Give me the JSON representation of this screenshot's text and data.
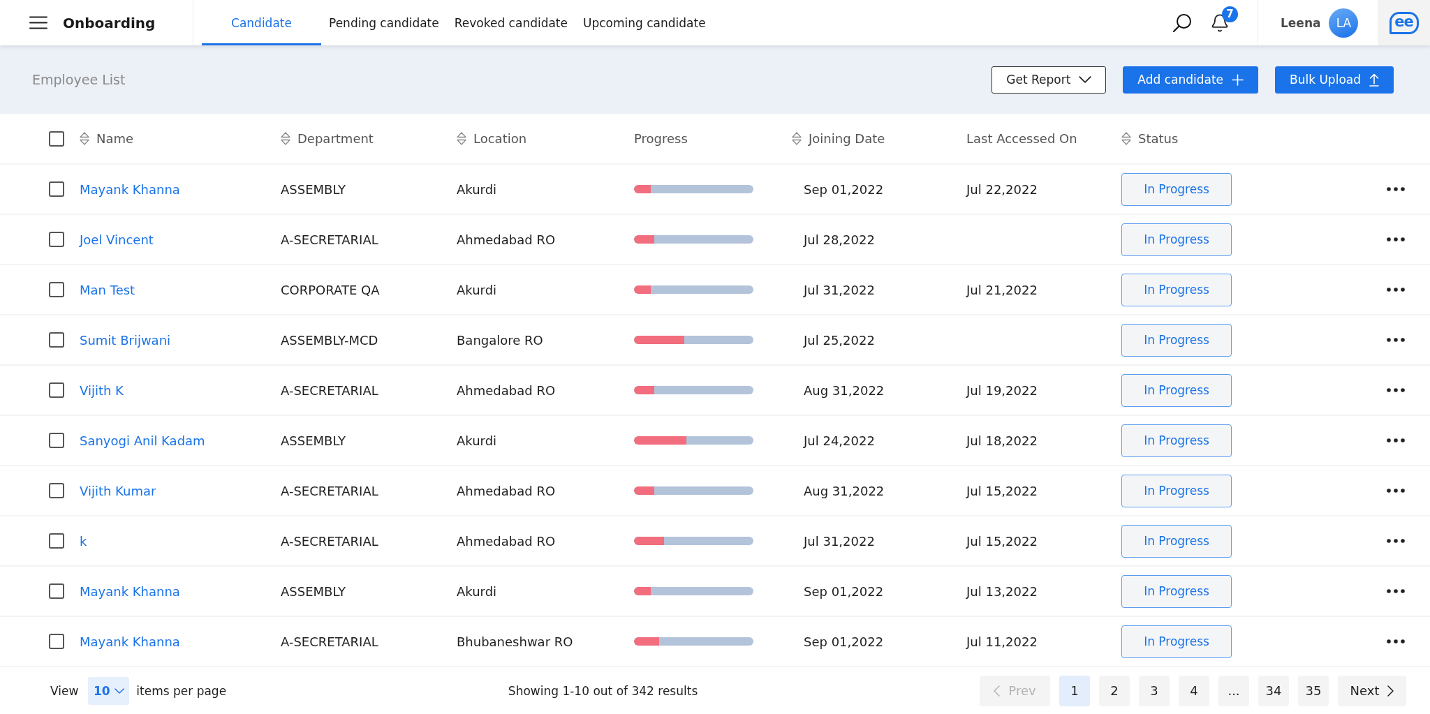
{
  "header": {
    "title": "Onboarding",
    "tabs": [
      {
        "label": "Candidate",
        "selected": true
      },
      {
        "label": "Pending candidate",
        "selected": false
      },
      {
        "label": "Revoked candidate",
        "selected": false
      },
      {
        "label": "Upcoming candidate",
        "selected": false
      }
    ],
    "notifications": {
      "count": "7"
    },
    "user": {
      "name": "Leena",
      "initials": "LA"
    },
    "logo": {
      "text": "ee"
    }
  },
  "toolbar": {
    "title": "Employee List",
    "buttons": [
      {
        "label": "Get Report",
        "kind": "dropdown"
      },
      {
        "label": "Add candidate",
        "kind": "add"
      },
      {
        "label": "Bulk Upload",
        "kind": "upload"
      }
    ]
  },
  "table": {
    "select_all": {
      "checked": false
    },
    "columns": [
      {
        "label": "Name",
        "sortable": true
      },
      {
        "label": "Department",
        "sortable": true
      },
      {
        "label": "Location",
        "sortable": true
      },
      {
        "label": "Progress",
        "sortable": false
      },
      {
        "label": "Joining Date",
        "sortable": true
      },
      {
        "label": "Last Accessed On",
        "sortable": false
      },
      {
        "label": "Status",
        "sortable": true
      }
    ],
    "rows": [
      {
        "checked": false,
        "name": "Mayank Khanna",
        "department": "ASSEMBLY",
        "location": "Akurdi",
        "progress": {
          "level": 0.14
        },
        "joining_date": "Sep 01,2022",
        "last_accessed_on": "Jul 22,2022",
        "status": "In Progress"
      },
      {
        "checked": false,
        "name": "Joel Vincent",
        "department": "A-SECRETARIAL",
        "location": "Ahmedabad RO",
        "progress": {
          "level": 0.17
        },
        "joining_date": "Jul 28,2022",
        "status": "In Progress"
      },
      {
        "checked": false,
        "name": "Man Test",
        "department": "CORPORATE QA",
        "location": "Akurdi",
        "progress": {
          "level": 0.14
        },
        "joining_date": "Jul 31,2022",
        "last_accessed_on": "Jul 21,2022",
        "status": "In Progress"
      },
      {
        "checked": false,
        "name": "Sumit Brijwani",
        "department": "ASSEMBLY-MCD",
        "location": "Bangalore RO",
        "progress": {
          "level": 0.42
        },
        "joining_date": "Jul 25,2022",
        "status": "In Progress"
      },
      {
        "checked": false,
        "name": "Vijith K",
        "department": "A-SECRETARIAL",
        "location": "Ahmedabad RO",
        "progress": {
          "level": 0.17
        },
        "joining_date": "Aug 31,2022",
        "last_accessed_on": "Jul 19,2022",
        "status": "In Progress"
      },
      {
        "checked": false,
        "name": "Sanyogi Anil Kadam",
        "department": "ASSEMBLY",
        "location": "Akurdi",
        "progress": {
          "level": 0.44
        },
        "joining_date": "Jul 24,2022",
        "last_accessed_on": "Jul 18,2022",
        "status": "In Progress"
      },
      {
        "checked": false,
        "name": "Vijith Kumar",
        "department": "A-SECRETARIAL",
        "location": "Ahmedabad RO",
        "progress": {
          "level": 0.17
        },
        "joining_date": "Aug 31,2022",
        "last_accessed_on": "Jul 15,2022",
        "status": "In Progress"
      },
      {
        "checked": false,
        "name": "k",
        "department": "A-SECRETARIAL",
        "location": "Ahmedabad RO",
        "progress": {
          "level": 0.25
        },
        "joining_date": "Jul 31,2022",
        "last_accessed_on": "Jul 15,2022",
        "status": "In Progress"
      },
      {
        "checked": false,
        "name": "Mayank Khanna",
        "department": "ASSEMBLY",
        "location": "Akurdi",
        "progress": {
          "level": 0.14
        },
        "joining_date": "Sep 01,2022",
        "last_accessed_on": "Jul 13,2022",
        "status": "In Progress"
      },
      {
        "checked": false,
        "name": "Mayank Khanna",
        "department": "A-SECRETARIAL",
        "location": "Bhubaneshwar RO",
        "progress": {
          "level": 0.21
        },
        "joining_date": "Sep 01,2022",
        "last_accessed_on": "Jul 11,2022",
        "status": "In Progress"
      }
    ]
  },
  "footer": {
    "view_label": "View",
    "page_size": {
      "value": "10"
    },
    "per_page_label": "items per page",
    "summary": "Showing 1-10 out of 342 results",
    "pagination": {
      "prev": {
        "label": "Prev",
        "disabled": true
      },
      "pages": [
        {
          "label": "1",
          "selected": true
        },
        {
          "label": "2",
          "selected": false
        },
        {
          "label": "3",
          "selected": false
        },
        {
          "label": "4",
          "selected": false
        },
        {
          "label": "...",
          "selected": false
        },
        {
          "label": "34",
          "selected": false
        },
        {
          "label": "35",
          "selected": false
        }
      ],
      "next": {
        "label": "Next",
        "disabled": false
      }
    }
  }
}
